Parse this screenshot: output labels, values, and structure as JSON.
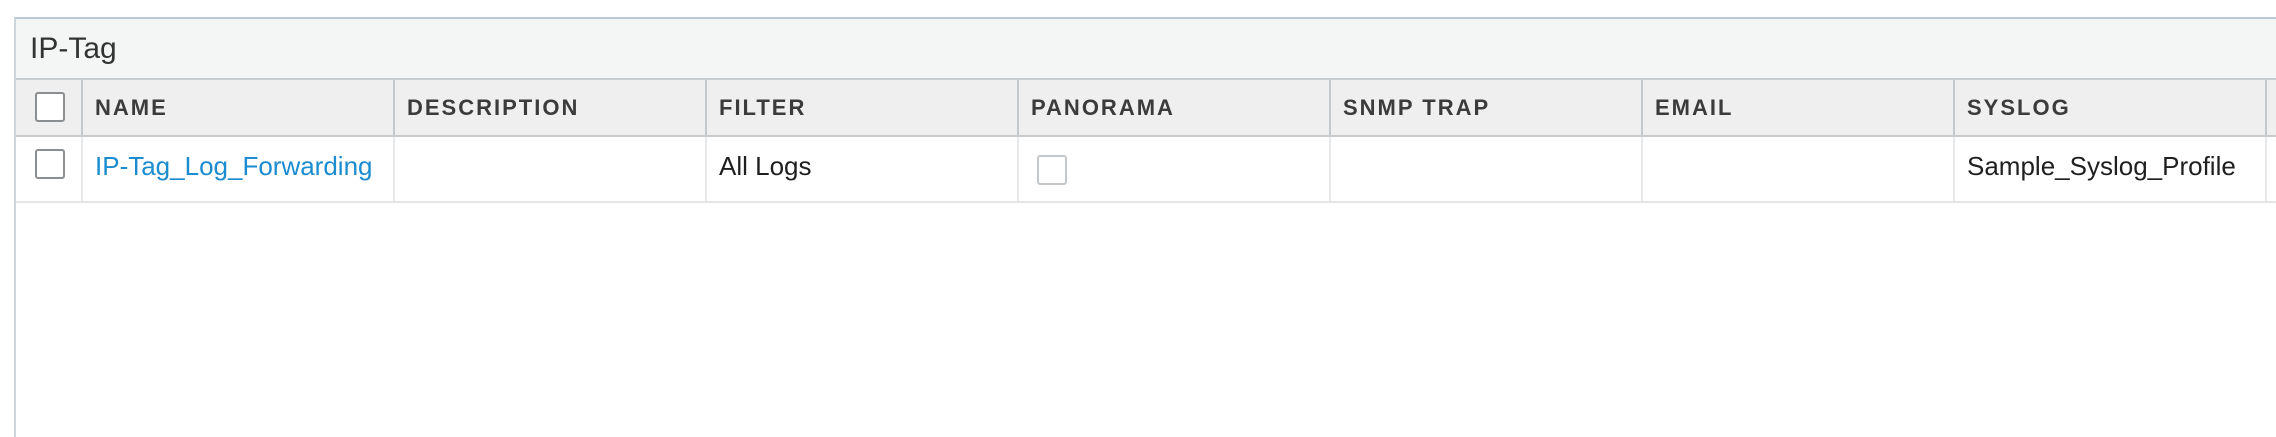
{
  "panel": {
    "title": "IP-Tag"
  },
  "table": {
    "columns": [
      {
        "label": ""
      },
      {
        "label": "NAME"
      },
      {
        "label": "DESCRIPTION"
      },
      {
        "label": "FILTER"
      },
      {
        "label": "PANORAMA"
      },
      {
        "label": "SNMP TRAP"
      },
      {
        "label": "EMAIL"
      },
      {
        "label": "SYSLOG"
      }
    ],
    "rows": [
      {
        "selected": false,
        "name": "IP-Tag_Log_Forwarding",
        "description": "",
        "filter": "All Logs",
        "panorama": false,
        "snmp_trap": "",
        "email": "",
        "syslog": "Sample_Syslog_Profile"
      }
    ]
  },
  "colors": {
    "link": "#1a8ccf",
    "header_bg": "#efefef",
    "titlebar_bg": "#f4f6f6"
  }
}
